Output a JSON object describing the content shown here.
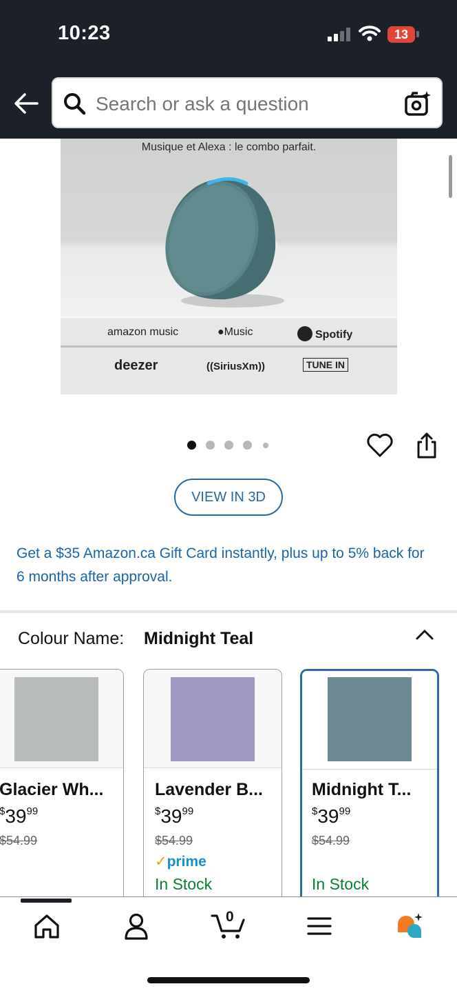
{
  "status_bar": {
    "time": "10:23",
    "battery": "13"
  },
  "search": {
    "placeholder": "Search or ask a question"
  },
  "product_image": {
    "caption": "Musique et Alexa : le combo parfait.",
    "logos": [
      "amazon music",
      "Music",
      "Spotify",
      "deezer",
      "((SiriusXm))",
      "TUNE IN"
    ]
  },
  "gallery": {
    "total_dots": 5,
    "active_dot": 1
  },
  "view3d": {
    "label": "VIEW IN 3D"
  },
  "promo": {
    "text": "Get a $35 Amazon.ca Gift Card instantly, plus up to 5% back for 6 months after approval."
  },
  "colour": {
    "label": "Colour Name:",
    "value": "Midnight Teal"
  },
  "variants": [
    {
      "name": "Glacier Wh...",
      "currency": "$",
      "price_whole": "39",
      "price_fraction": "99",
      "list_price": "$54.99",
      "prime": "",
      "stock": "",
      "color": "#b7bbbb",
      "selected": false
    },
    {
      "name": "Lavender B...",
      "currency": "$",
      "price_whole": "39",
      "price_fraction": "99",
      "list_price": "$54.99",
      "prime": "prime",
      "stock": "In Stock",
      "color": "#9f9ac4",
      "selected": false
    },
    {
      "name": "Midnight T...",
      "currency": "$",
      "price_whole": "39",
      "price_fraction": "99",
      "list_price": "$54.99",
      "prime": "",
      "stock": "In Stock",
      "color": "#6d8991",
      "selected": true
    }
  ],
  "bottom_nav": {
    "cart_count": "0"
  },
  "colors": {
    "header_bg": "#1c2129",
    "link_blue": "#1a64a7",
    "stock_green": "#087f32",
    "selected_border": "#2c6aa8",
    "prime_blue": "#1a8fd1",
    "prime_check": "#f09c1a"
  }
}
